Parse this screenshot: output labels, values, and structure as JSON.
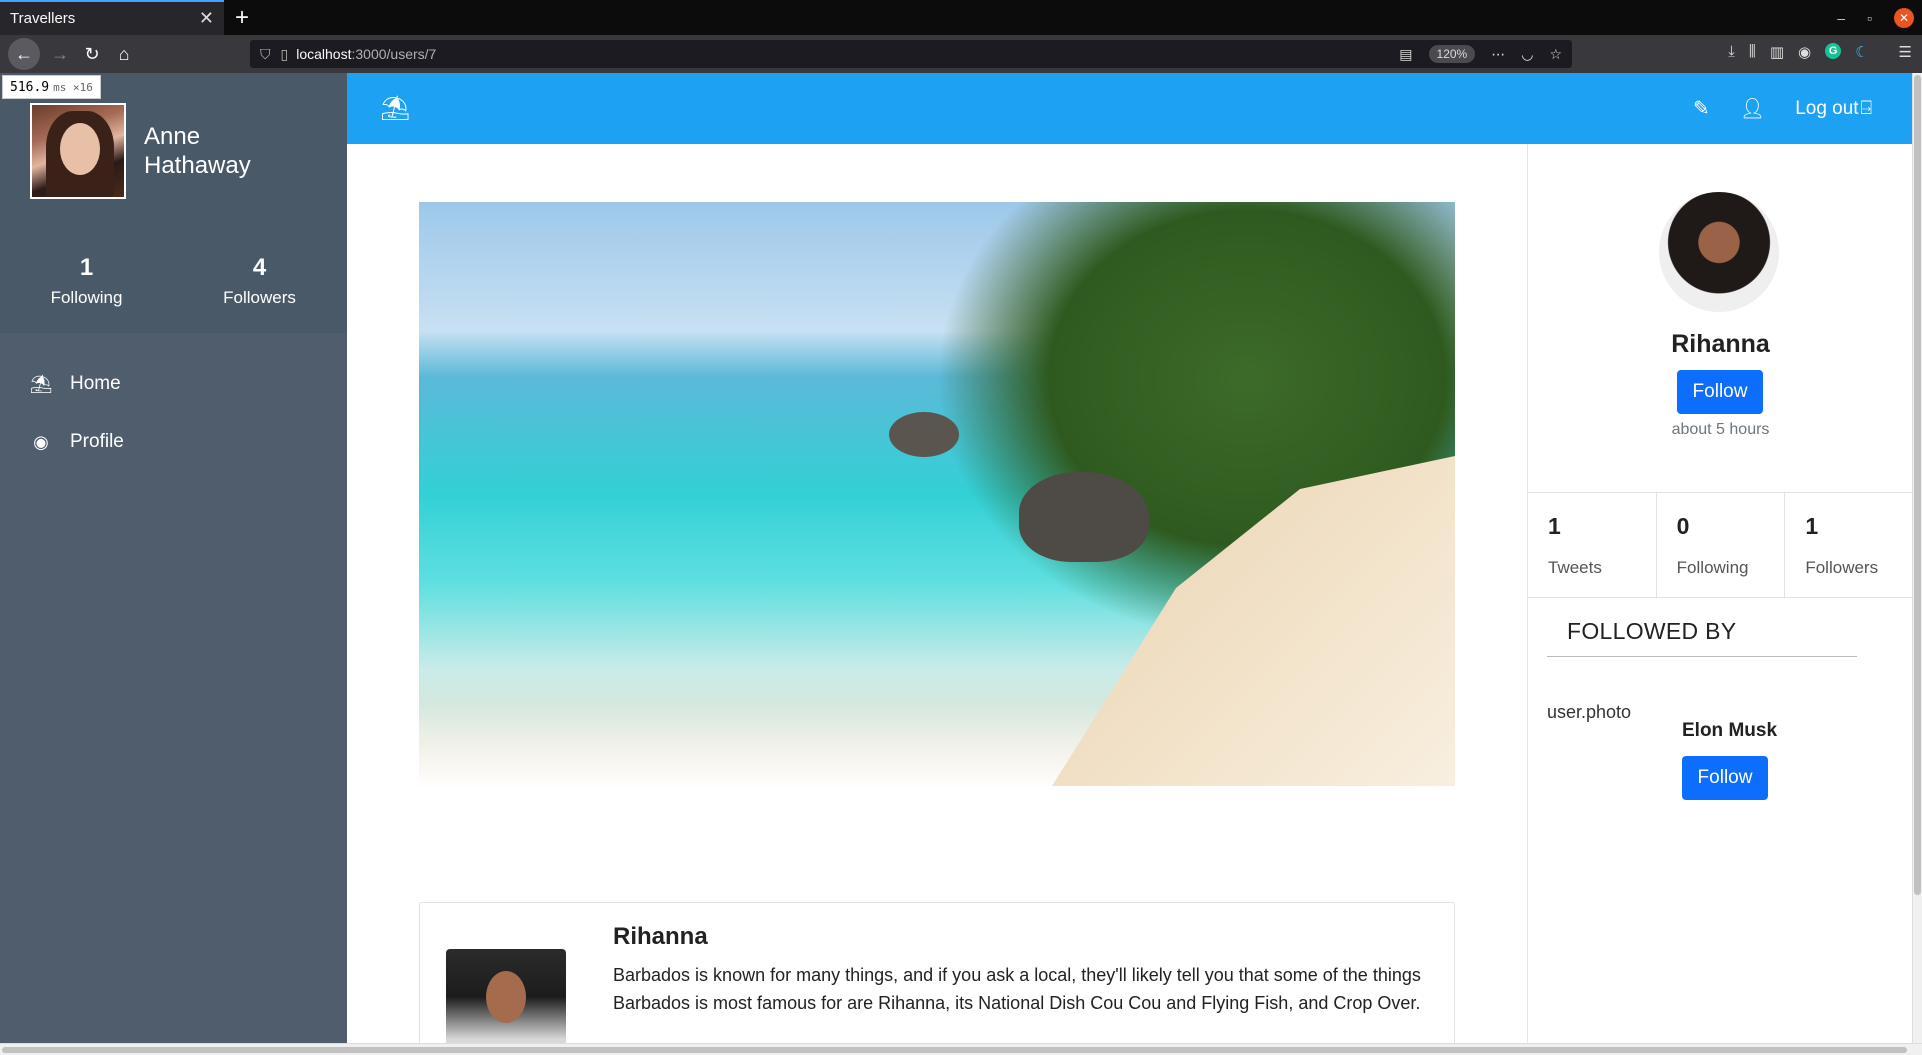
{
  "browser": {
    "tab_title": "Travellers",
    "tab_close": "✕",
    "new_tab": "+",
    "url_host": "localhost",
    "url_path": ":3000/users/7",
    "zoom": "120%"
  },
  "perf": {
    "value": "516.9",
    "unit": "ms ×16"
  },
  "sidebar": {
    "user_name": "Anne Hathaway",
    "following_count": "1",
    "following_label": "Following",
    "followers_count": "4",
    "followers_label": "Followers",
    "items": [
      {
        "label": "Home",
        "icon": "umbrella-beach-icon"
      },
      {
        "label": "Profile",
        "icon": "user-circle-icon"
      }
    ]
  },
  "appbar": {
    "logout_label": "Log out"
  },
  "tweet": {
    "author": "Rihanna",
    "text": "Barbados is known for many things, and if you ask a local, they'll likely tell you that some of the things Barbados is most famous for are Rihanna, its National Dish Cou Cou and Flying Fish, and Crop Over."
  },
  "profile": {
    "name": "Rihanna",
    "follow_label": "Follow",
    "since": "about 5 hours",
    "stats": [
      {
        "value": "1",
        "label": "Tweets"
      },
      {
        "value": "0",
        "label": "Following"
      },
      {
        "value": "1",
        "label": "Followers"
      }
    ],
    "followed_by_title": "FOLLOWED BY",
    "followers": [
      {
        "photo_alt": "user.photo",
        "name": "Elon Musk",
        "follow_label": "Follow"
      }
    ]
  },
  "colors": {
    "appbar": "#1da1f2",
    "sidebar": "#4a5968",
    "button": "#0d6efd"
  }
}
